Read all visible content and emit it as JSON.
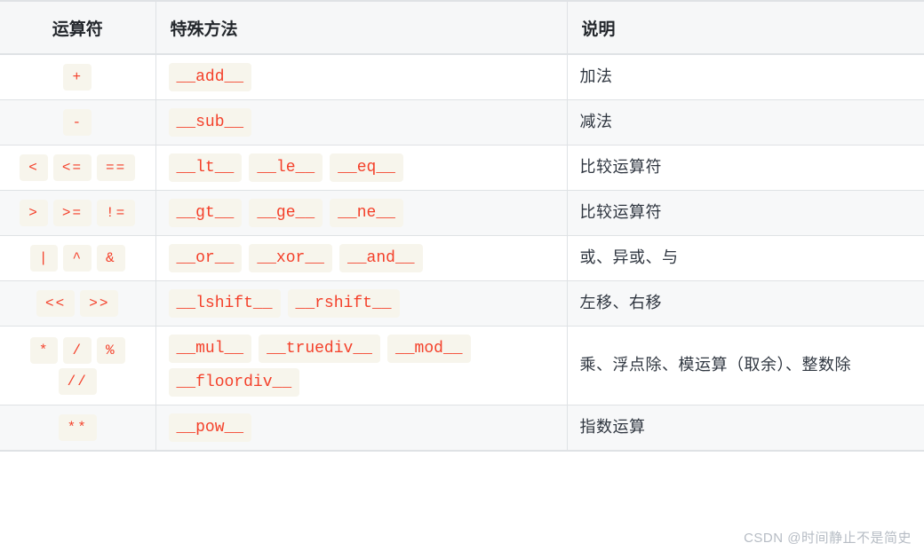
{
  "table": {
    "headers": {
      "operator": "运算符",
      "method": "特殊方法",
      "description": "说明"
    },
    "rows": [
      {
        "operators": [
          "+"
        ],
        "methods": [
          "__add__"
        ],
        "description": "加法"
      },
      {
        "operators": [
          "-"
        ],
        "methods": [
          "__sub__"
        ],
        "description": "减法"
      },
      {
        "operators": [
          "<",
          "<=",
          "=="
        ],
        "methods": [
          "__lt__",
          "__le__",
          "__eq__"
        ],
        "description": "比较运算符"
      },
      {
        "operators": [
          ">",
          ">=",
          "!="
        ],
        "methods": [
          "__gt__",
          "__ge__",
          "__ne__"
        ],
        "description": "比较运算符"
      },
      {
        "operators": [
          "|",
          "^",
          "&"
        ],
        "methods": [
          "__or__",
          "__xor__",
          "__and__"
        ],
        "description": "或、异或、与"
      },
      {
        "operators": [
          "<<",
          ">>"
        ],
        "methods": [
          "__lshift__",
          "__rshift__"
        ],
        "description": "左移、右移"
      },
      {
        "operators": [
          "*",
          "/",
          "%",
          "//"
        ],
        "methods": [
          "__mul__",
          "__truediv__",
          "__mod__",
          "__floordiv__"
        ],
        "description": "乘、浮点除、模运算（取余）、整数除"
      },
      {
        "operators": [
          "**"
        ],
        "methods": [
          "__pow__"
        ],
        "description": "指数运算"
      }
    ]
  },
  "watermark": {
    "text": "CSDN @时间静止不是简史"
  },
  "colors": {
    "badge_background": "#f7f5ec",
    "badge_text": "#f4402a",
    "header_background": "#f6f7f8",
    "border": "#dfe2e5",
    "row_alt_background": "#f7f8f9",
    "body_text": "#2f3640",
    "watermark_text": "#b6bcc4"
  }
}
